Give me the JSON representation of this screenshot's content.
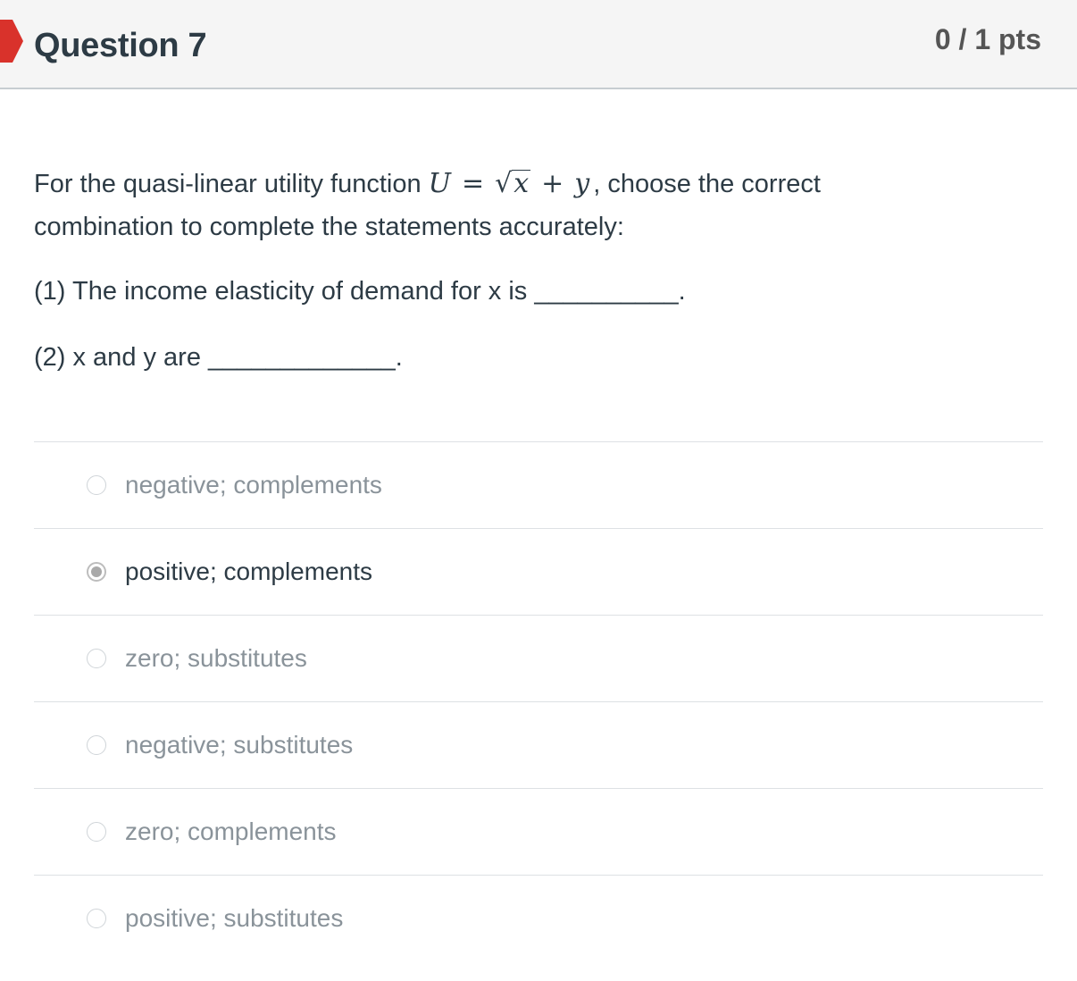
{
  "header": {
    "title": "Question 7",
    "points": "0 / 1 pts"
  },
  "question": {
    "line1_before": "For the quasi-linear utility function ",
    "math_U": "U",
    "math_eq": "=",
    "math_x": "x",
    "math_plus": "+",
    "math_y": "y",
    "line1_after": ", choose the correct",
    "line2": "combination to complete the statements accurately:",
    "statement1": "(1) The income elasticity of demand for x is __________.",
    "statement2": "(2) x and y are _____________."
  },
  "answers": [
    {
      "label": "negative; complements",
      "selected": false
    },
    {
      "label": "positive; complements",
      "selected": true
    },
    {
      "label": "zero; substitutes",
      "selected": false
    },
    {
      "label": "negative; substitutes",
      "selected": false
    },
    {
      "label": "zero; complements",
      "selected": false
    },
    {
      "label": "positive; substitutes",
      "selected": false
    }
  ],
  "colors": {
    "flag": "#d9322b",
    "header_bg": "#f5f5f5",
    "text": "#2d3b45",
    "muted": "#8a939a"
  }
}
